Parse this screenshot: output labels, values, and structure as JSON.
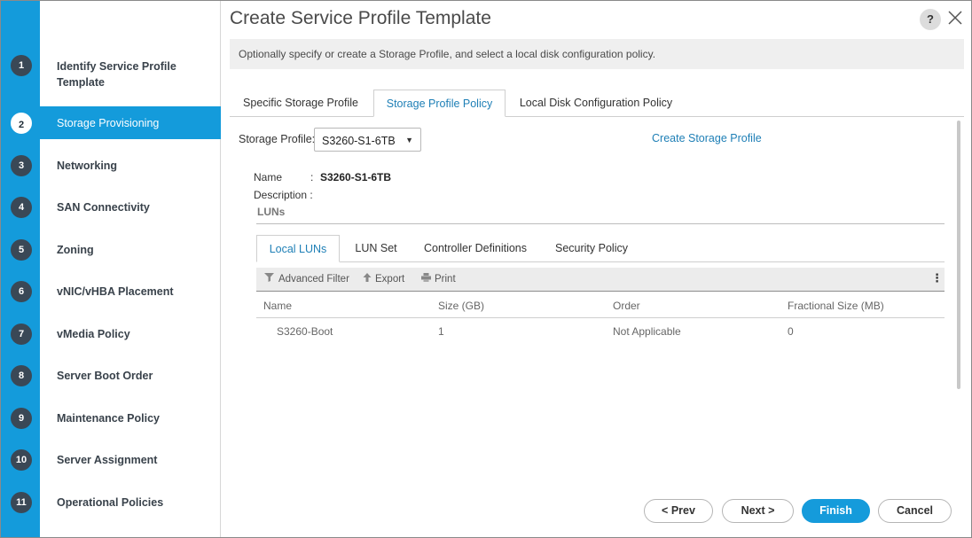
{
  "title": "Create Service Profile Template",
  "help_label": "?",
  "banner": "Optionally specify or create a Storage Profile, and select a local disk configuration policy.",
  "steps": [
    {
      "num": "1",
      "label": "Identify Service Profile Template",
      "line1": "Identify Service Profile",
      "line2": "Template"
    },
    {
      "num": "2",
      "label": "Storage Provisioning"
    },
    {
      "num": "3",
      "label": "Networking"
    },
    {
      "num": "4",
      "label": "SAN Connectivity"
    },
    {
      "num": "5",
      "label": "Zoning"
    },
    {
      "num": "6",
      "label": "vNIC/vHBA Placement"
    },
    {
      "num": "7",
      "label": "vMedia Policy"
    },
    {
      "num": "8",
      "label": "Server Boot Order"
    },
    {
      "num": "9",
      "label": "Maintenance Policy"
    },
    {
      "num": "10",
      "label": "Server Assignment"
    },
    {
      "num": "11",
      "label": "Operational Policies"
    }
  ],
  "tabs": [
    "Specific Storage Profile",
    "Storage Profile Policy",
    "Local Disk Configuration Policy"
  ],
  "storage_profile": {
    "label": "Storage Profile:",
    "selected": "S3260-S1-6TB",
    "create_link": "Create Storage Profile",
    "name_label": "Name",
    "name_sep": ":",
    "name_value": "S3260-S1-6TB",
    "description_label": "Description :",
    "luns_title": "LUNs"
  },
  "inner_tabs": [
    "Local LUNs",
    "LUN Set",
    "Controller Definitions",
    "Security Policy"
  ],
  "toolbar": {
    "filter": "Advanced Filter",
    "export": "Export",
    "print": "Print"
  },
  "table": {
    "columns": [
      "Name",
      "Size (GB)",
      "Order",
      "Fractional Size (MB)"
    ],
    "rows": [
      [
        "S3260-Boot",
        "1",
        "Not Applicable",
        "0"
      ]
    ]
  },
  "buttons": {
    "prev": "< Prev",
    "next": "Next >",
    "finish": "Finish",
    "cancel": "Cancel"
  }
}
